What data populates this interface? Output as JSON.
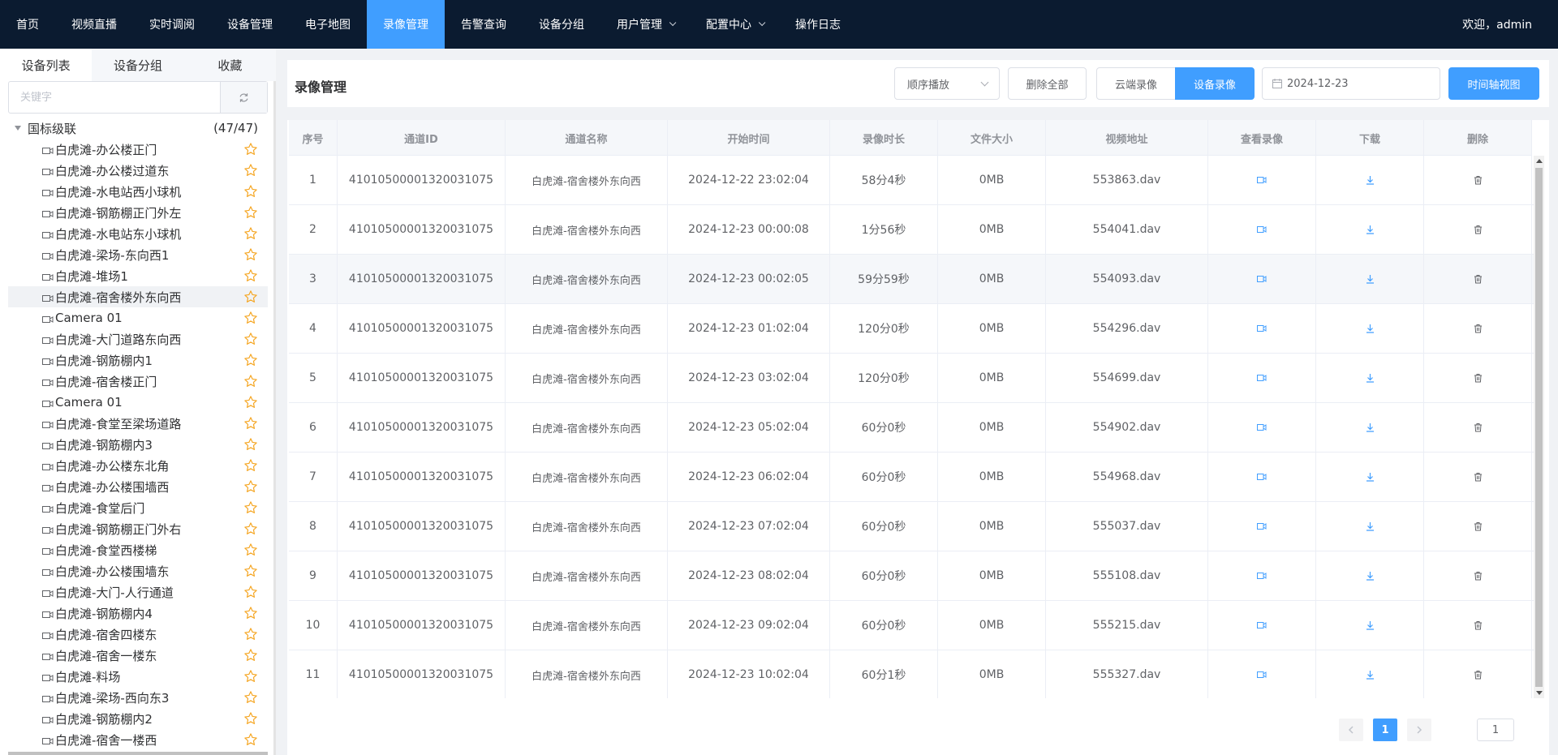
{
  "nav": {
    "items": [
      {
        "label": "首页"
      },
      {
        "label": "视频直播"
      },
      {
        "label": "实时调阅"
      },
      {
        "label": "设备管理"
      },
      {
        "label": "电子地图"
      },
      {
        "label": "录像管理",
        "active": true
      },
      {
        "label": "告警查询"
      },
      {
        "label": "设备分组"
      },
      {
        "label": "用户管理",
        "dropdown": true
      },
      {
        "label": "配置中心",
        "dropdown": true
      },
      {
        "label": "操作日志"
      }
    ],
    "welcome": "欢迎，admin"
  },
  "sidebar": {
    "tabs": [
      {
        "label": "设备列表"
      },
      {
        "label": "设备分组"
      },
      {
        "label": "收藏"
      }
    ],
    "search_placeholder": "关键字",
    "tree": {
      "root_label": "国标级联",
      "root_count": "(47/47)",
      "items": [
        "白虎滩-办公楼正门",
        "白虎滩-办公楼过道东",
        "白虎滩-水电站西小球机",
        "白虎滩-钢筋棚正门外左",
        "白虎滩-水电站东小球机",
        "白虎滩-梁场-东向西1",
        "白虎滩-堆场1",
        "白虎滩-宿舍楼外东向西",
        "Camera 01",
        "白虎滩-大门道路东向西",
        "白虎滩-钢筋棚内1",
        "白虎滩-宿舍楼正门",
        "Camera 01",
        "白虎滩-食堂至梁场道路",
        "白虎滩-钢筋棚内3",
        "白虎滩-办公楼东北角",
        "白虎滩-办公楼围墙西",
        "白虎滩-食堂后门",
        "白虎滩-钢筋棚正门外右",
        "白虎滩-食堂西楼梯",
        "白虎滩-办公楼围墙东",
        "白虎滩-大门-人行通道",
        "白虎滩-钢筋棚内4",
        "白虎滩-宿舍四楼东",
        "白虎滩-宿舍一楼东",
        "白虎滩-料场",
        "白虎滩-梁场-西向东3",
        "白虎滩-钢筋棚内2",
        "白虎滩-宿舍一楼西"
      ],
      "selected_index": 7
    }
  },
  "main": {
    "title": "录像管理",
    "play_mode": "顺序播放",
    "delete_all": "删除全部",
    "cloud_record": "云端录像",
    "device_record": "设备录像",
    "date": "2024-12-23",
    "timeline_view": "时间轴视图",
    "columns": [
      "序号",
      "通道ID",
      "通道名称",
      "开始时间",
      "录像时长",
      "文件大小",
      "视频地址",
      "查看录像",
      "下载",
      "删除"
    ],
    "rows": [
      {
        "no": "1",
        "channel_id": "41010500001320031075",
        "channel_name": "白虎滩-宿舍楼外东向西",
        "start": "2024-12-22 23:02:04",
        "duration": "58分4秒",
        "size": "0MB",
        "file": "553863.dav"
      },
      {
        "no": "2",
        "channel_id": "41010500001320031075",
        "channel_name": "白虎滩-宿舍楼外东向西",
        "start": "2024-12-23 00:00:08",
        "duration": "1分56秒",
        "size": "0MB",
        "file": "554041.dav"
      },
      {
        "no": "3",
        "channel_id": "41010500001320031075",
        "channel_name": "白虎滩-宿舍楼外东向西",
        "start": "2024-12-23 00:02:05",
        "duration": "59分59秒",
        "size": "0MB",
        "file": "554093.dav"
      },
      {
        "no": "4",
        "channel_id": "41010500001320031075",
        "channel_name": "白虎滩-宿舍楼外东向西",
        "start": "2024-12-23 01:02:04",
        "duration": "120分0秒",
        "size": "0MB",
        "file": "554296.dav"
      },
      {
        "no": "5",
        "channel_id": "41010500001320031075",
        "channel_name": "白虎滩-宿舍楼外东向西",
        "start": "2024-12-23 03:02:04",
        "duration": "120分0秒",
        "size": "0MB",
        "file": "554699.dav"
      },
      {
        "no": "6",
        "channel_id": "41010500001320031075",
        "channel_name": "白虎滩-宿舍楼外东向西",
        "start": "2024-12-23 05:02:04",
        "duration": "60分0秒",
        "size": "0MB",
        "file": "554902.dav"
      },
      {
        "no": "7",
        "channel_id": "41010500001320031075",
        "channel_name": "白虎滩-宿舍楼外东向西",
        "start": "2024-12-23 06:02:04",
        "duration": "60分0秒",
        "size": "0MB",
        "file": "554968.dav"
      },
      {
        "no": "8",
        "channel_id": "41010500001320031075",
        "channel_name": "白虎滩-宿舍楼外东向西",
        "start": "2024-12-23 07:02:04",
        "duration": "60分0秒",
        "size": "0MB",
        "file": "555037.dav"
      },
      {
        "no": "9",
        "channel_id": "41010500001320031075",
        "channel_name": "白虎滩-宿舍楼外东向西",
        "start": "2024-12-23 08:02:04",
        "duration": "60分0秒",
        "size": "0MB",
        "file": "555108.dav"
      },
      {
        "no": "10",
        "channel_id": "41010500001320031075",
        "channel_name": "白虎滩-宿舍楼外东向西",
        "start": "2024-12-23 09:02:04",
        "duration": "60分0秒",
        "size": "0MB",
        "file": "555215.dav"
      },
      {
        "no": "11",
        "channel_id": "41010500001320031075",
        "channel_name": "白虎滩-宿舍楼外东向西",
        "start": "2024-12-23 10:02:04",
        "duration": "60分1秒",
        "size": "0MB",
        "file": "555327.dav"
      }
    ],
    "highlight_row": 2,
    "pagination": {
      "current": "1",
      "jump_value": "1"
    }
  },
  "colors": {
    "nav_bg": "#0b1b30",
    "accent": "#409eff",
    "star": "#f5a623"
  }
}
